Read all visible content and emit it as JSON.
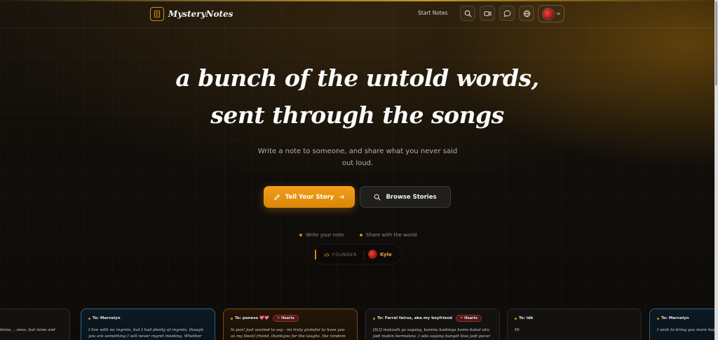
{
  "brand": {
    "name": "MysteryNotes",
    "icon": "notebook-icon"
  },
  "nav": {
    "link": "Start Notes",
    "buttons": [
      {
        "name": "search-button",
        "icon": "search-icon"
      },
      {
        "name": "video-button",
        "icon": "video-camera-icon"
      },
      {
        "name": "chat-button",
        "icon": "chat-bubble-icon"
      },
      {
        "name": "language-button",
        "icon": "globe-icon"
      }
    ]
  },
  "hero": {
    "line1": "a bunch of the untold words,",
    "line2": "sent through the songs",
    "subtitle": "Write a note to someone, and share what you never said out loud.",
    "cta_label": "Tell Your Story",
    "browse_label": "Browse Stories",
    "step1": "Write your note",
    "step2": "Share with the world",
    "founder_label": "FOUNDER",
    "founder_name": "Kyle"
  },
  "cards": [
    {
      "to": "",
      "tag": "",
      "style": "gray",
      "body": "...nes I'm older. Though emotions, ...ness, but mine and these letters"
    },
    {
      "to": "To: Marvelyn",
      "tag": "",
      "style": "blue",
      "body": "I live with no regrets, but I had plenty of regrets, though you are something I will never regret meeting. Whether you do something"
    },
    {
      "to": "To: paneso 💖💖",
      "tag": "Hearts",
      "style": "amber",
      "body": "hi pan! just wanted to say - im truly grateful to have you as my (best) friend. thankyou for the laughs, the random jokes, and the"
    },
    {
      "to": "To: Farrel fairuz, aka my boyfriend",
      "tag": "Hearts",
      "style": "gray",
      "body": "[ILI] makasih ya sayang, karena kadonya kamu bakal aku jadi makin bermakna :) ada sayang banget bisa jadi pacar kamu, and i'm"
    },
    {
      "to": "To: idk",
      "tag": "",
      "style": "gray",
      "body": "Hi"
    },
    {
      "to": "To: Marvelyn",
      "tag": "",
      "style": "blue",
      "body": "I wish to bring you more happiness to, but I'll try anyways"
    }
  ],
  "colors": {
    "accent": "#f2a019",
    "background": "#0d0b08",
    "card_blue": "#46a0dc",
    "card_amber": "#c8781e"
  }
}
